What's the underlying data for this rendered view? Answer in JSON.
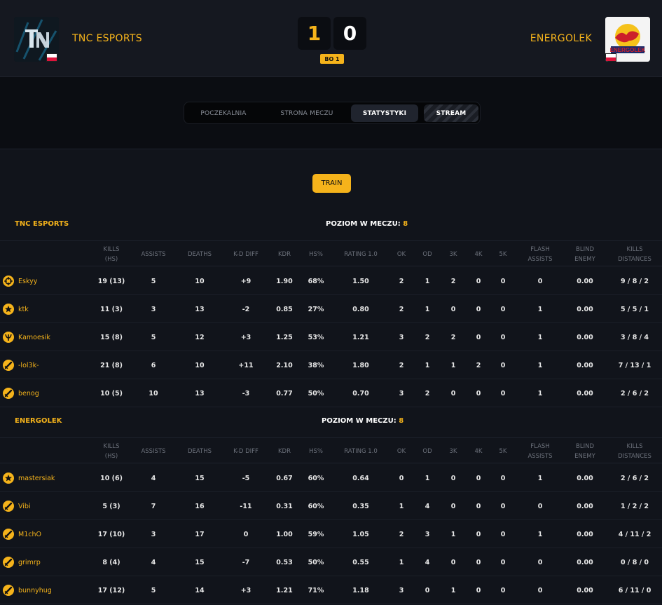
{
  "colors": {
    "accent": "#f5b31b",
    "bg": "#0b0d12",
    "panel": "#11141b"
  },
  "match": {
    "team1": {
      "name": "TNC ESPORTS",
      "score": "1"
    },
    "team2": {
      "name": "ENERGOLEK",
      "score": "0",
      "logo_text": "ENERGOLEK"
    },
    "format": "BO 1"
  },
  "tabs": [
    {
      "label": "POCZEKALNIA"
    },
    {
      "label": "STRONA MECZU"
    },
    {
      "label": "STATYSTYKI"
    },
    {
      "label": "STREAM"
    }
  ],
  "map_button": "TRAIN",
  "level_label": "POZIOM W MECZU:",
  "headers": [
    "KILLS\n(HS)",
    "ASSISTS",
    "DEATHS",
    "K-D DIFF",
    "KDR",
    "HS%",
    "RATING 1.0",
    "OK",
    "OD",
    "3K",
    "4K",
    "5K",
    "FLASH\nASSISTS",
    "BLIND\nENEMY",
    "KILLS\nDISTANCES"
  ],
  "teams": [
    {
      "name": "TNC ESPORTS",
      "level": "8",
      "players": [
        {
          "icon": "crosshair-icon",
          "name": "Eskyy",
          "stats": [
            "19 (13)",
            "5",
            "10",
            "+9",
            "1.90",
            "68%",
            "1.50",
            "2",
            "1",
            "2",
            "0",
            "0",
            "0",
            "0.00",
            "9 / 8 / 2"
          ]
        },
        {
          "icon": "star-icon",
          "name": "ktk",
          "stats": [
            "11 (3)",
            "3",
            "13",
            "-2",
            "0.85",
            "27%",
            "0.80",
            "2",
            "1",
            "0",
            "0",
            "0",
            "1",
            "0.00",
            "5 / 5 / 1"
          ]
        },
        {
          "icon": "trident-icon",
          "name": "Kamoesik",
          "stats": [
            "15 (8)",
            "5",
            "12",
            "+3",
            "1.25",
            "53%",
            "1.21",
            "3",
            "2",
            "2",
            "0",
            "0",
            "1",
            "0.00",
            "3 / 8 / 4"
          ]
        },
        {
          "icon": "slash-icon",
          "name": "-lol3k-",
          "stats": [
            "21 (8)",
            "6",
            "10",
            "+11",
            "2.10",
            "38%",
            "1.80",
            "2",
            "1",
            "1",
            "2",
            "0",
            "1",
            "0.00",
            "7 / 13 / 1"
          ]
        },
        {
          "icon": "slash-icon",
          "name": "benog",
          "stats": [
            "10 (5)",
            "10",
            "13",
            "-3",
            "0.77",
            "50%",
            "0.70",
            "3",
            "2",
            "0",
            "0",
            "0",
            "1",
            "0.00",
            "2 / 6 / 2"
          ]
        }
      ]
    },
    {
      "name": "ENERGOLEK",
      "level": "8",
      "players": [
        {
          "icon": "star-icon",
          "name": "mastersiak",
          "stats": [
            "10 (6)",
            "4",
            "15",
            "-5",
            "0.67",
            "60%",
            "0.64",
            "0",
            "1",
            "0",
            "0",
            "0",
            "1",
            "0.00",
            "2 / 6 / 2"
          ]
        },
        {
          "icon": "slash-icon",
          "name": "Vibi",
          "stats": [
            "5 (3)",
            "7",
            "16",
            "-11",
            "0.31",
            "60%",
            "0.35",
            "1",
            "4",
            "0",
            "0",
            "0",
            "0",
            "0.00",
            "1 / 2 / 2"
          ]
        },
        {
          "icon": "slash-icon",
          "name": "M1chO",
          "stats": [
            "17 (10)",
            "3",
            "17",
            "0",
            "1.00",
            "59%",
            "1.05",
            "2",
            "3",
            "1",
            "0",
            "0",
            "1",
            "0.00",
            "4 / 11 / 2"
          ]
        },
        {
          "icon": "slash-icon",
          "name": "grimrp",
          "stats": [
            "8 (4)",
            "4",
            "15",
            "-7",
            "0.53",
            "50%",
            "0.55",
            "1",
            "4",
            "0",
            "0",
            "0",
            "0",
            "0.00",
            "0 / 8 / 0"
          ]
        },
        {
          "icon": "slash-icon",
          "name": "bunnyhug",
          "stats": [
            "17 (12)",
            "5",
            "14",
            "+3",
            "1.21",
            "71%",
            "1.18",
            "3",
            "0",
            "1",
            "0",
            "0",
            "0",
            "0.00",
            "6 / 11 / 0"
          ]
        }
      ]
    }
  ]
}
